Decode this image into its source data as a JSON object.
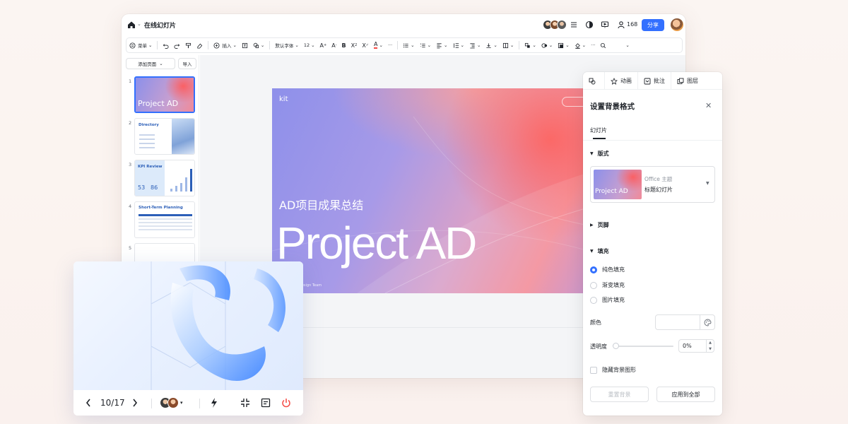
{
  "titlebar": {
    "doc_title": "在线幻灯片",
    "users_count": "168",
    "share_label": "分享"
  },
  "toolbar": {
    "menu_label": "菜单",
    "insert_label": "插入",
    "font_label": "默认字体",
    "font_size": "12"
  },
  "thumbnails": {
    "add_page_label": "添加页面",
    "import_label": "导入",
    "numbers": [
      "1",
      "2",
      "3",
      "4",
      "5"
    ],
    "slide1_title": "Project AD",
    "slide2_title": "Directory",
    "slide3_title": "KPI Review",
    "slide3_values": [
      "53",
      "86"
    ],
    "slide4_title": "Short-Term Planning"
  },
  "slide": {
    "brand": "kit",
    "subtitle": "AD项目成果总结",
    "title": "Project AD",
    "footer": "Design Team"
  },
  "presenter_bar": {
    "page_counter": "10/17"
  },
  "side_panel": {
    "tabs": [
      "动画",
      "批注",
      "图层"
    ],
    "title": "设置背景格式",
    "subtab": "幻灯片",
    "layout_section": "版式",
    "layout_theme": "Office 主题",
    "layout_name": "标题幻灯片",
    "layout_thumb_text": "Project AD",
    "footer_section": "页脚",
    "fill_section": "填充",
    "fill_options": [
      "纯色填充",
      "渐变填充",
      "图片填充"
    ],
    "fill_selected": 0,
    "color_label": "颜色",
    "opacity_label": "透明度",
    "opacity_value": "0%",
    "hide_bg_label": "隐藏背景图形",
    "reset_label": "重置背景",
    "apply_all_label": "应用到全部"
  },
  "colors": {
    "accent": "#3370ff",
    "record": "#f54a45"
  }
}
